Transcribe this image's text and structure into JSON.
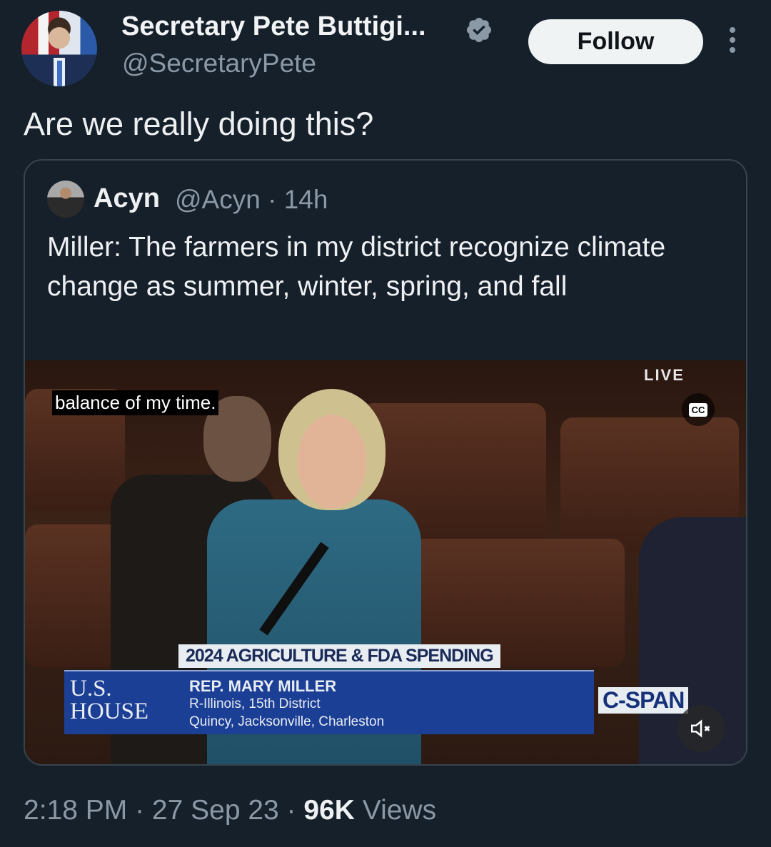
{
  "author": {
    "name": "Secretary Pete Buttigi...",
    "handle": "@SecretaryPete",
    "follow_label": "Follow"
  },
  "tweet": {
    "text": "Are we really doing this?"
  },
  "quoted": {
    "name": "Acyn",
    "handle_time": "@Acyn · 14h",
    "text": "Miller: The farmers in my district recognize climate change as summer, winter, spring, and fall"
  },
  "video": {
    "caption": "balance of my time.",
    "live_label": "LIVE",
    "cc_label": "CC",
    "chyron_title": "2024 AGRICULTURE & FDA SPENDING",
    "house_label_1": "U.S.",
    "house_label_2": "HOUSE",
    "rep_name": "REP. MARY MILLER",
    "rep_district": "R-Illinois, 15th District",
    "rep_towns": "Quincy, Jacksonville, Charleston",
    "network": "C-SPAN"
  },
  "footer": {
    "time_date": "2:18 PM · 27 Sep 23 · ",
    "views_count": "96K",
    "views_label": " Views"
  },
  "colors": {
    "background": "#15202b",
    "verified": "#8b98a5",
    "muted_text": "#8b98a5"
  }
}
